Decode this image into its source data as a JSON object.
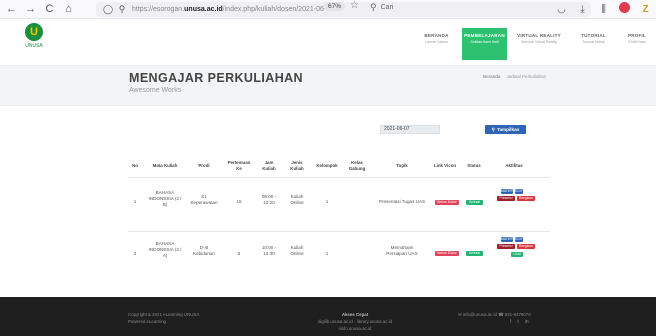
{
  "browser": {
    "back": "←",
    "forward": "→",
    "reload": "C",
    "home": "⌂",
    "url_prefix": "https://esorogan.",
    "url_domain": "unusa.ac.id",
    "url_path": "/index.php/kuliah/dosen/2021-06-07",
    "zoom": "67%",
    "search_placeholder": "Cari"
  },
  "site": {
    "logo_text": "UNUSA",
    "logo_mark": "U",
    "menu": [
      {
        "title": "BERANDA",
        "sub": "Laman Utama",
        "active": false
      },
      {
        "title": "PEMBELAJARAN",
        "sub": "Sekilas Kami Ikuti",
        "active": true
      },
      {
        "title": "VIRTUAL REALITY",
        "sub": "Sekolah Virtual Reality",
        "active": false
      },
      {
        "title": "TUTORIAL",
        "sub": "Tutorial Kuliah",
        "active": false
      },
      {
        "title": "PROFIL",
        "sub": "Profil Kami",
        "active": false
      }
    ]
  },
  "page": {
    "title": "MENGAJAR PERKULIAHAN",
    "subtitle": "Awesome Works",
    "crumbs": [
      "Beranda",
      "Jadwal Perkuliahan"
    ]
  },
  "filter": {
    "date_value": "2021-06-07",
    "button_label": "Tampilkan"
  },
  "table": {
    "headers": {
      "no": "No",
      "matkul": "Mata Kuliah",
      "prodi": "Prodi",
      "pertemuan_1": "Pertemuan",
      "pertemuan_2": "Ke",
      "jam_1": "Jam",
      "jam_2": "Kuliah",
      "jenis_1": "Jenis",
      "jenis_2": "Kuliah",
      "kelompok": "Kelompok",
      "kelas_1": "Kelas",
      "kelas_2": "Gabung",
      "topik": "Topik",
      "link": "Link Vicon",
      "status": "Status",
      "aktifitas": "Aktifitas"
    },
    "rows": [
      {
        "no": "1",
        "matkul_1": "BAHASA",
        "matkul_2": "INDONESIA (2 /",
        "matkul_3": "B)",
        "prodi_1": "S1",
        "prodi_2": "Keperawatan",
        "pertemuan": "15",
        "jam_1": "08:00 -",
        "jam_2": "10:20",
        "jenis_1": "Kuliah",
        "jenis_2": "Online",
        "kelompok": "1",
        "topik": "Presentasi Tugas UAS",
        "link_badge": "Belum Diatur",
        "status_badge": "Selesai",
        "act_1": "MATERI",
        "act_2": "EDIT",
        "act_3": "Presensi",
        "act_4": "Rangkum"
      },
      {
        "no": "2",
        "matkul_1": "BAHASA",
        "matkul_2": "INDONESIA (2 /",
        "matkul_3": "A)",
        "prodi_1": "D-III",
        "prodi_2": "Kebidanan",
        "pertemuan": "5",
        "jam_1": "10:00 -",
        "jam_2": "14:30",
        "jenis_1": "Kuliah",
        "jenis_2": "Online",
        "kelompok": "1",
        "topik_1": "Memahami",
        "topik_2": "Persiapan UAS",
        "link_badge": "Belum Diatur",
        "status_badge": "Selesai",
        "act_1": "MATERI",
        "act_2": "EDIT",
        "act_3": "Presensi",
        "act_4": "Rangkum",
        "act_5": "Lihat"
      }
    ]
  },
  "footer": {
    "left_1": "Copyright & 2021 eLearning UNUSA.",
    "left_2": "Powered eLearning",
    "center_head": "Akses Cepat",
    "center_1": "digilib.unusa.ac.id · library.unusa.ac.id",
    "center_2": "sisfo.unusa.ac.id",
    "right": "✉ info@unusa.ac.id   ☎ 031-8479070",
    "social": [
      "f",
      "t",
      "in"
    ]
  },
  "colors": {
    "accent_green": "#2ec270",
    "button_blue": "#2f64b6",
    "badge_red": "#e0445c",
    "badge_green": "#22b573",
    "footer_bg": "#1f1f1f"
  }
}
